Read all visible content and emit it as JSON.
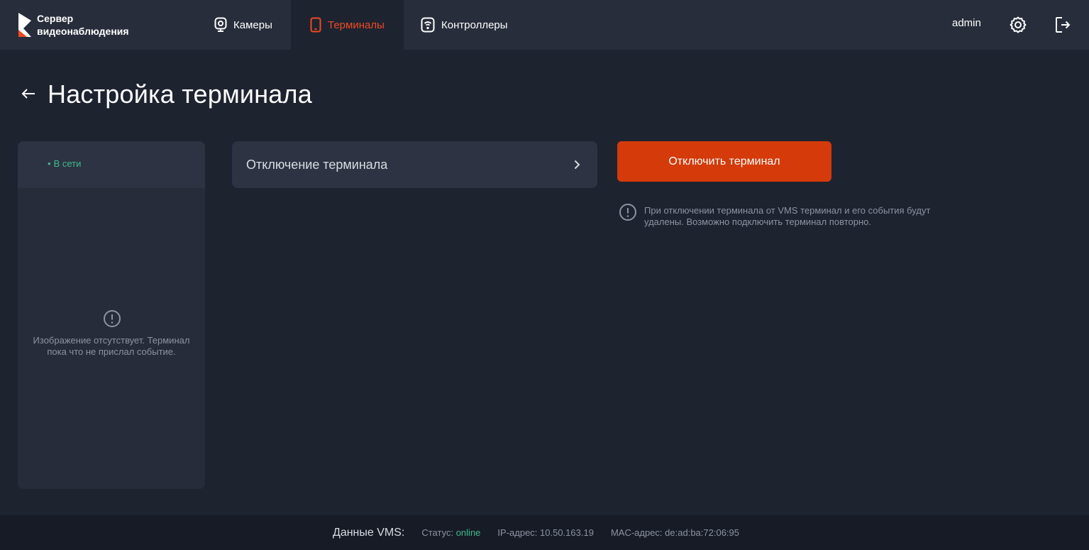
{
  "header": {
    "logo_line1": "Сервер",
    "logo_line2": "видеонаблюдения",
    "nav": [
      {
        "label": "Камеры",
        "icon": "camera-icon"
      },
      {
        "label": "Терминалы",
        "icon": "tablet-icon"
      },
      {
        "label": "Контроллеры",
        "icon": "controller-icon"
      }
    ],
    "user": "admin"
  },
  "colors": {
    "accent": "#ee4a22",
    "button": "#d43a0a",
    "online": "#3dbb8c",
    "background": "#1e2330"
  },
  "page": {
    "title": "Настройка терминала"
  },
  "terminal_card": {
    "status": "В сети",
    "no_image_text": "Изображение отсутствует. Терминал пока что не прислал событие."
  },
  "menu": {
    "disconnect_label": "Отключение терминала"
  },
  "action": {
    "button_label": "Отключить терминал",
    "hint": "При отключении терминала от VMS терминал и его события будут удалены. Возможно подключить терминал повторно."
  },
  "footer": {
    "title": "Данные VMS:",
    "status_label": "Статус:",
    "status_value": "online",
    "ip_label": "IP-адрес:",
    "ip_value": "10.50.163.19",
    "mac_label": "MAC-адрес:",
    "mac_value": "de:ad:ba:72:06:95"
  }
}
